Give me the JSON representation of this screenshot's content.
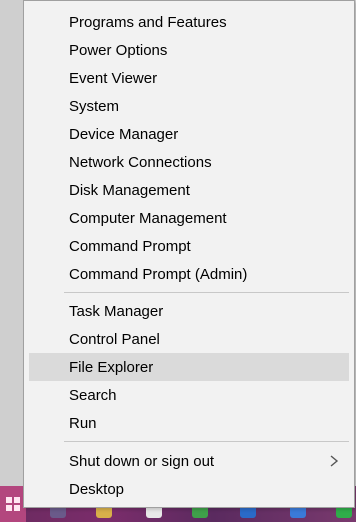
{
  "menu": {
    "group1": [
      {
        "label": "Programs and Features"
      },
      {
        "label": "Power Options"
      },
      {
        "label": "Event Viewer"
      },
      {
        "label": "System"
      },
      {
        "label": "Device Manager"
      },
      {
        "label": "Network Connections"
      },
      {
        "label": "Disk Management"
      },
      {
        "label": "Computer Management"
      },
      {
        "label": "Command Prompt"
      },
      {
        "label": "Command Prompt (Admin)"
      }
    ],
    "group2": [
      {
        "label": "Task Manager"
      },
      {
        "label": "Control Panel"
      },
      {
        "label": "File Explorer",
        "highlighted": true
      },
      {
        "label": "Search"
      },
      {
        "label": "Run"
      }
    ],
    "group3": [
      {
        "label": "Shut down or sign out",
        "submenu_icon": "chevron-right-icon"
      },
      {
        "label": "Desktop"
      }
    ]
  },
  "colors": {
    "menu_background": "#f2f2f2",
    "highlight": "#dadada",
    "taskbar": "#6a2a5f",
    "start_button": "#b3467e"
  }
}
